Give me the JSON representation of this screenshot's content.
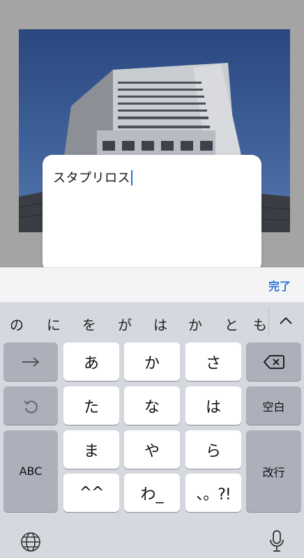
{
  "editor": {
    "text": "スタプリロス"
  },
  "accessory": {
    "done_label": "完了"
  },
  "candidates": [
    "の",
    "に",
    "を",
    "が",
    "は",
    "か",
    "と",
    "も"
  ],
  "candidate_expand_icon": "chevron-up-icon",
  "keys": {
    "row1": {
      "left": "arrow-right-icon",
      "k1": "あ",
      "k2": "か",
      "k3": "さ",
      "right": "delete-icon"
    },
    "row2": {
      "left": "undo-icon",
      "k1": "た",
      "k2": "な",
      "k3": "は",
      "right": "空白"
    },
    "row3": {
      "left": "ABC",
      "k1": "ま",
      "k2": "や",
      "k3": "ら",
      "right": "改行"
    },
    "row4": {
      "k1": "^^",
      "k2": "わ_",
      "k3": "、。?!"
    }
  },
  "bottom": {
    "globe": "globe-icon",
    "mic": "microphone-icon"
  },
  "colors": {
    "accent": "#2b73d9",
    "keyboard_bg": "#d5d8de",
    "special_key": "#abb0bb"
  }
}
